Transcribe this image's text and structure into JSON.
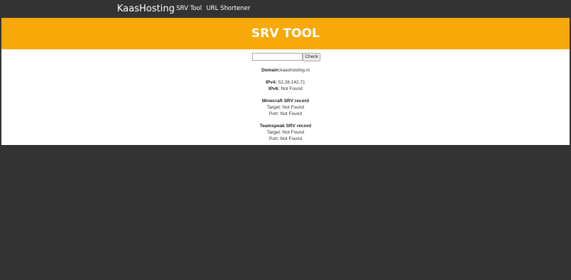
{
  "navbar": {
    "brand": "KaasHosting",
    "links": [
      "SRV Tool",
      "URL Shortener"
    ]
  },
  "hero": {
    "title": "SRV TOOL"
  },
  "form": {
    "input_value": "",
    "button_label": "Check"
  },
  "result": {
    "domain": {
      "label": "Domain:",
      "value": "kaashosting.nl"
    },
    "ipv4": {
      "label": "IPv4:",
      "value": "52.28.142.71"
    },
    "ipv6": {
      "label": "IPv6:",
      "value": "Not Found"
    },
    "minecraft": {
      "heading": "Minecraft SRV record",
      "target": {
        "label": "Target:",
        "value": "Not Found"
      },
      "port": {
        "label": "Port:",
        "value": "Not Found"
      }
    },
    "teamspeak": {
      "heading": "Teamspeak SRV record",
      "target": {
        "label": "Target:",
        "value": "Not Found"
      },
      "port": {
        "label": "Port:",
        "value": "Not Found"
      }
    }
  },
  "colors": {
    "background": "#333333",
    "accent": "#f7a90a",
    "content": "#ffffff"
  }
}
